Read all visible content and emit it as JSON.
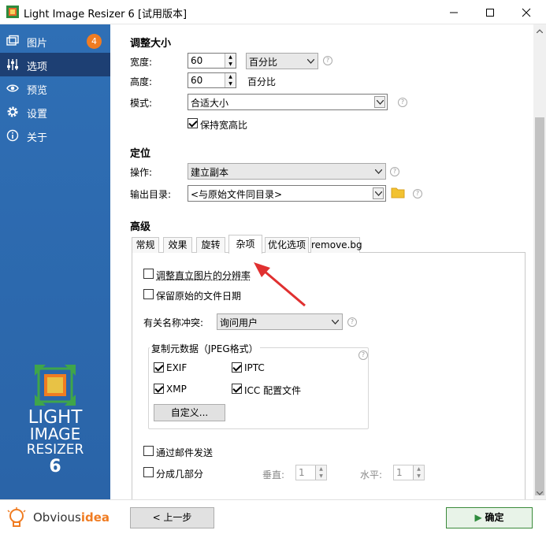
{
  "window": {
    "title": "Light Image Resizer 6  [试用版本]"
  },
  "sidebar": {
    "items": [
      {
        "label": "图片",
        "icon": "images-icon",
        "badge": "4"
      },
      {
        "label": "选项",
        "icon": "sliders-icon",
        "active": true
      },
      {
        "label": "预览",
        "icon": "eye-icon"
      },
      {
        "label": "设置",
        "icon": "gear-icon"
      },
      {
        "label": "关于",
        "icon": "info-icon"
      }
    ],
    "logo": {
      "line1": "LIGHT",
      "line2": "IMAGE",
      "line3": "RESIZER",
      "line4": "6"
    },
    "brand": {
      "prefix": "Obvious",
      "suffix": "idea!"
    }
  },
  "resize": {
    "section_title": "调整大小",
    "width_label": "宽度:",
    "width_value": "60",
    "unit_value": "百分比",
    "height_label": "高度:",
    "height_value": "60",
    "height_unit": "百分比",
    "mode_label": "模式:",
    "mode_value": "合适大小",
    "keep_ratio_label": "保持宽高比"
  },
  "position": {
    "section_title": "定位",
    "action_label": "操作:",
    "action_value": "建立副本",
    "output_label": "输出目录:",
    "output_value": "<与原始文件同目录>"
  },
  "advanced": {
    "section_title": "高级",
    "tabs": [
      "常规",
      "效果",
      "旋转",
      "杂项",
      "优化选项",
      "remove.bg"
    ],
    "active_tab": "杂项",
    "misc": {
      "adjust_dpi_label": "调整直立图片的分辨率",
      "keep_date_label": "保留原始的文件日期",
      "conflict_label": "有关名称冲突:",
      "conflict_value": "询问用户",
      "metadata_title": "复制元数据（JPEG格式）",
      "exif": "EXIF",
      "iptc": "IPTC",
      "xmp": "XMP",
      "icc": "ICC 配置文件",
      "custom_button": "自定义...",
      "email_label": "通过邮件发送",
      "split_label": "分成几部分",
      "vertical_label": "垂直:",
      "vertical_value": "1",
      "horizontal_label": "水平:",
      "horizontal_value": "1"
    }
  },
  "footer": {
    "back_button": "< 上一步",
    "ok_button": "确定"
  },
  "colors": {
    "sidebar": "#2f6fb5",
    "sidebar_active": "#1d3f73",
    "badge": "#f07c22",
    "annotation_arrow": "#e03030",
    "folder": "#f2c230"
  }
}
